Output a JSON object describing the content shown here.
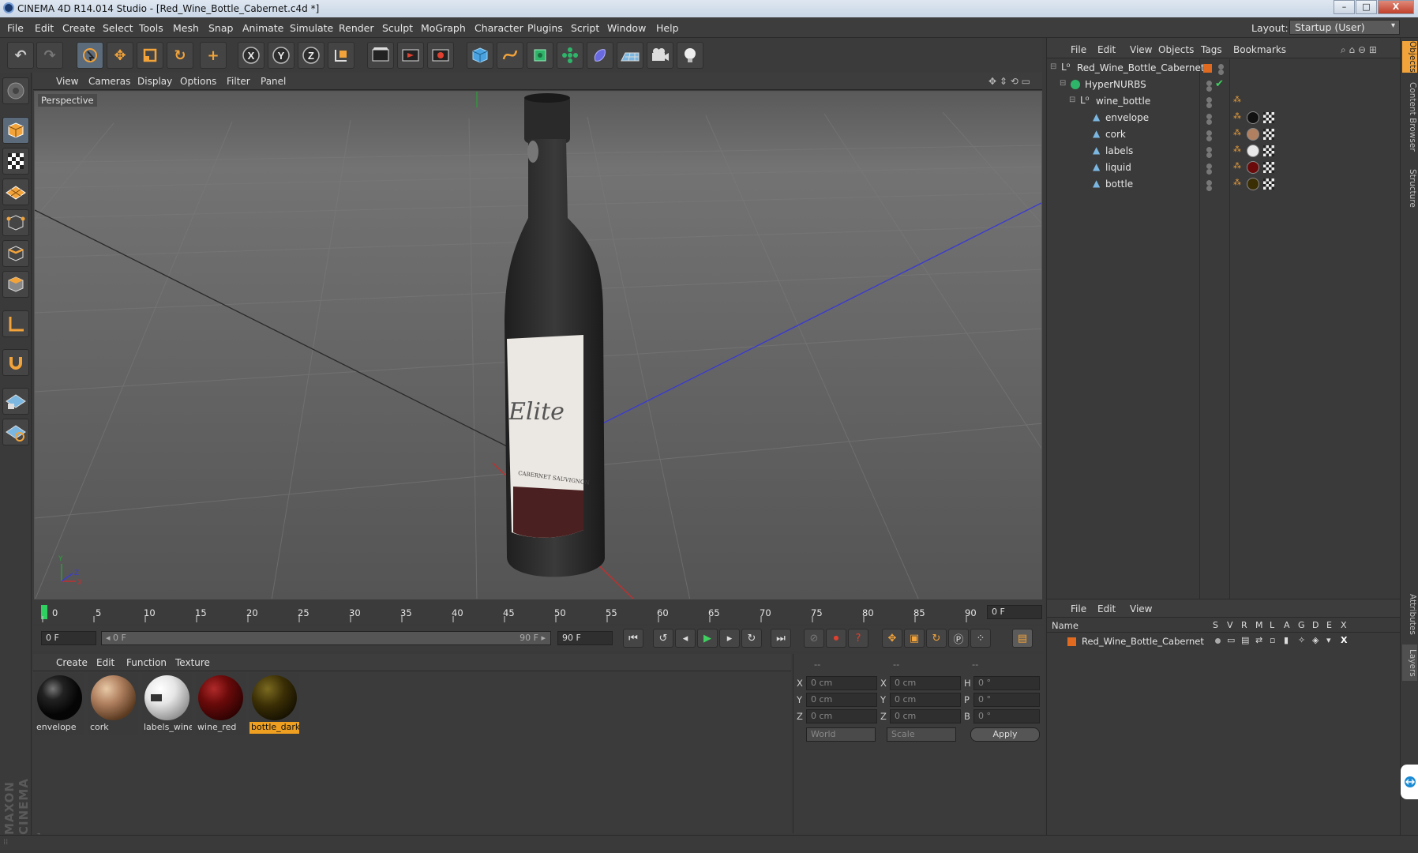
{
  "window": {
    "title": "CINEMA 4D R14.014 Studio - [Red_Wine_Bottle_Cabernet.c4d *]",
    "minimize_label": "–",
    "maximize_label": "□",
    "close_label": "X"
  },
  "menubar": {
    "items": [
      "File",
      "Edit",
      "Create",
      "Select",
      "Tools",
      "Mesh",
      "Snap",
      "Animate",
      "Simulate",
      "Render",
      "Sculpt",
      "MoGraph",
      "Character",
      "Plugins",
      "Script",
      "Window",
      "Help"
    ],
    "layout_label": "Layout:",
    "layout_value": "Startup (User)"
  },
  "toolbar": {
    "icons": [
      "undo-icon",
      "redo-icon",
      "live-selection-icon",
      "move-icon",
      "scale-icon",
      "rotate-icon",
      "add-icon",
      "x-axis-lock-icon",
      "y-axis-lock-icon",
      "z-axis-lock-icon",
      "coordinate-system-icon",
      "render-view-icon",
      "render-picture-viewer-icon",
      "render-settings-icon",
      "cube-icon",
      "spline-pen-icon",
      "subdivision-surface-icon",
      "array-icon",
      "deformer-icon",
      "floor-icon",
      "camera-icon",
      "light-icon"
    ],
    "axis_letters": [
      "X",
      "Y",
      "Z"
    ]
  },
  "viewport": {
    "menu": [
      "View",
      "Cameras",
      "Display",
      "Options",
      "Filter",
      "Panel"
    ],
    "label": "Perspective",
    "label_text_on_bottle": "Elite",
    "label_subtext": "CABERNET SAUVIGNON",
    "axis_labels": [
      "Y",
      "Z",
      "X"
    ],
    "colors": {
      "bottle": "#2a2a2a",
      "label": "#e8e4df",
      "label_band": "#4a2020",
      "grid_bg": "#5e5e5e",
      "axis_blue": "#3b3bd0",
      "axis_red": "#c03030"
    }
  },
  "timeline": {
    "ticks": [
      "0",
      "5",
      "10",
      "15",
      "20",
      "25",
      "30",
      "35",
      "40",
      "45",
      "50",
      "55",
      "60",
      "65",
      "70",
      "75",
      "80",
      "85",
      "90"
    ],
    "current_frame": "0 F",
    "start_frame": "0 F",
    "range_start": "◂ 0 F",
    "range_end": "90 F ▸",
    "end_frame": "90 F"
  },
  "materials": {
    "menu": [
      "Create",
      "Edit",
      "Function",
      "Texture"
    ],
    "items": [
      {
        "name": "envelope",
        "color": "#111111"
      },
      {
        "name": "cork",
        "color": "#b08060"
      },
      {
        "name": "labels_wine",
        "color": "#e8e8e8"
      },
      {
        "name": "wine_red",
        "color": "#6a0a0a"
      },
      {
        "name": "bottle_dark",
        "color": "#3a2e05"
      }
    ],
    "selected": "bottle_dark"
  },
  "coordinates": {
    "header": [
      "--",
      "--",
      "--"
    ],
    "rows": [
      {
        "a": "X",
        "av": "0 cm",
        "b": "X",
        "bv": "0 cm",
        "c": "H",
        "cv": "0 °"
      },
      {
        "a": "Y",
        "av": "0 cm",
        "b": "Y",
        "bv": "0 cm",
        "c": "P",
        "cv": "0 °"
      },
      {
        "a": "Z",
        "av": "0 cm",
        "b": "Z",
        "bv": "0 cm",
        "c": "B",
        "cv": "0 °"
      }
    ],
    "world": "World",
    "scale": "Scale",
    "apply": "Apply"
  },
  "objects": {
    "menu": [
      "File",
      "Edit",
      "View",
      "Objects",
      "Tags",
      "Bookmarks"
    ],
    "tree": [
      {
        "name": "Red_Wine_Bottle_Cabernet",
        "level": 0,
        "type": "null"
      },
      {
        "name": "HyperNURBS",
        "level": 1,
        "type": "nurbs"
      },
      {
        "name": "wine_bottle",
        "level": 2,
        "type": "null"
      },
      {
        "name": "envelope",
        "level": 3,
        "type": "mesh",
        "mat": "#111111"
      },
      {
        "name": "cork",
        "level": 3,
        "type": "mesh",
        "mat": "#b08060"
      },
      {
        "name": "labels",
        "level": 3,
        "type": "mesh",
        "mat": "#e8e8e8"
      },
      {
        "name": "liquid",
        "level": 3,
        "type": "mesh",
        "mat": "#6a0a0a"
      },
      {
        "name": "bottle",
        "level": 3,
        "type": "mesh",
        "mat": "#3a2e05"
      }
    ]
  },
  "layers": {
    "menu": [
      "File",
      "Edit",
      "View"
    ],
    "columns": [
      "Name",
      "S",
      "V",
      "R",
      "M",
      "L",
      "A",
      "G",
      "D",
      "E",
      "X"
    ],
    "row_name": "Red_Wine_Bottle_Cabernet",
    "accent": "#e06a20"
  },
  "side_tabs": [
    "Objects",
    "Content Browser",
    "Structure",
    "Attributes",
    "Layers"
  ],
  "brand": "MAXON CINEMA 4D"
}
